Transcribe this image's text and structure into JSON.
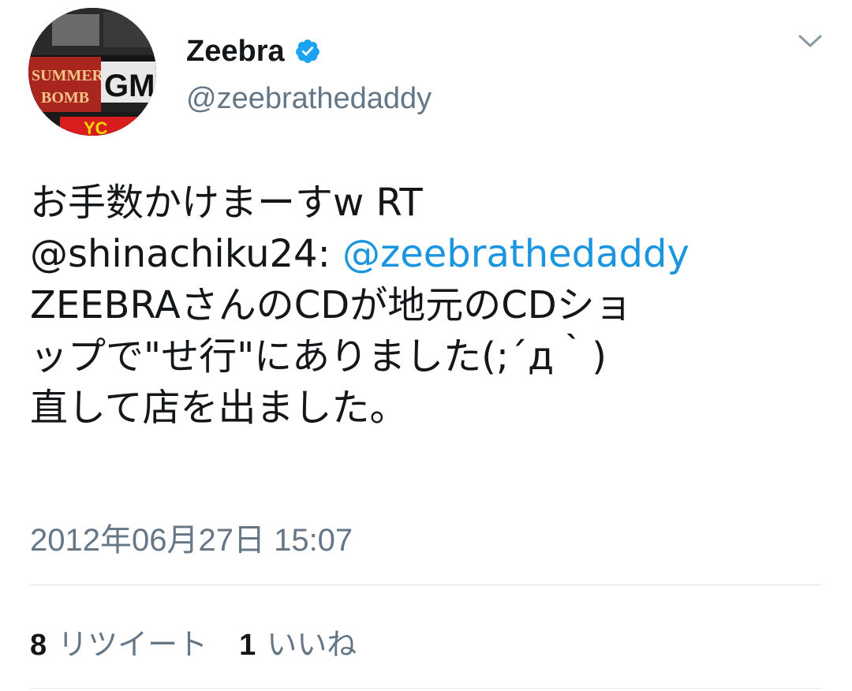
{
  "author": {
    "display_name": "Zeebra",
    "handle": "@zeebrathedaddy",
    "verified": true,
    "avatar_icon": "avatar-image"
  },
  "tweet": {
    "lines": [
      {
        "segments": [
          {
            "text": "お手数かけまーすw RT",
            "mention": false
          }
        ]
      },
      {
        "segments": [
          {
            "text": "@shinachiku24: ",
            "mention": false
          },
          {
            "text": "@zeebrathedaddy",
            "mention": true
          }
        ]
      },
      {
        "segments": [
          {
            "text": "ZEEBRAさんのCDが地元のCDショ",
            "mention": false
          }
        ]
      },
      {
        "segments": [
          {
            "text": "ップで\"せ行\"にありました(;´д｀)",
            "mention": false
          }
        ]
      },
      {
        "segments": [
          {
            "text": "直して店を出ました。",
            "mention": false
          }
        ]
      }
    ],
    "timestamp": "2012年06月27日 15:07"
  },
  "stats": {
    "retweets": {
      "count": "8",
      "label": "リツイート"
    },
    "likes": {
      "count": "1",
      "label": "いいね"
    }
  },
  "colors": {
    "text": "#14171a",
    "secondary": "#657786",
    "link": "#1b95e0",
    "verified": "#1da1f2",
    "divider": "#e1e8ed"
  },
  "icons": {
    "verified": "verified-badge-icon",
    "more": "chevron-down-icon"
  }
}
